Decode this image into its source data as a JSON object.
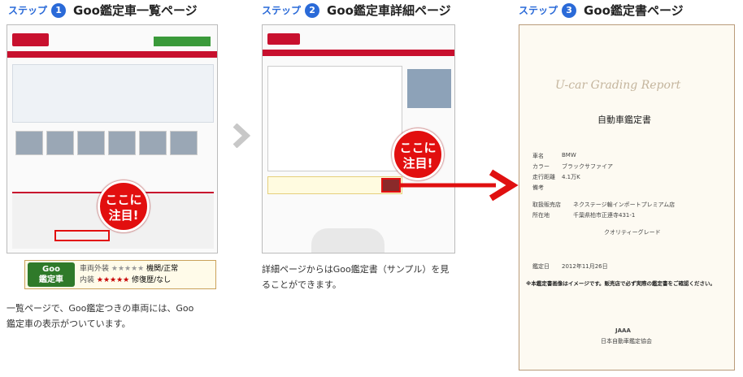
{
  "steps": [
    {
      "label": "ステップ",
      "num": "1",
      "title": "Goo鑑定車一覧ページ"
    },
    {
      "label": "ステップ",
      "num": "2",
      "title": "Goo鑑定車詳細ページ"
    },
    {
      "label": "ステップ",
      "num": "3",
      "title": "Goo鑑定書ページ"
    }
  ],
  "callout": {
    "line1": "ここに",
    "line2": "注目!"
  },
  "badge": {
    "logo_top": "Goo",
    "logo_bottom": "鑑定車",
    "row1_key": "車両外装",
    "row1_stars": "★★★★★",
    "row1_val": "機関/正常",
    "row2_key": "内装",
    "row2_stars": "★★★★★",
    "row2_val": "修復歴/なし"
  },
  "desc1": {
    "line1": "一覧ページで、Goo鑑定つきの車両には、Goo",
    "line2": "鑑定車の表示がついています。"
  },
  "desc2": {
    "line1": "詳細ページからはGoo鑑定書（サンプル）を見",
    "line2": "ることができます。"
  },
  "report": {
    "en_title": "U-car Grading Report",
    "jp_title": "自動車鑑定書",
    "name_label": "車名",
    "name_val": "BMW",
    "color_label": "カラー",
    "color_val": "ブラックサファイア",
    "mileage_label": "走行距離",
    "mileage_val": "4.1万K",
    "note_label": "備考",
    "shop_label": "取扱販売店",
    "shop_val": "ネクステージ輸インポートプレミアム店",
    "addr_label": "所在地",
    "addr_val": "千葉県柏市正連寺431-1",
    "quality_title": "クオリティーグレード",
    "date_label": "鑑定日",
    "date_val": "2012年11月26日",
    "notice": "※本鑑定書画像はイメージです。販売店で必ず実際の鑑定書をご確認ください。",
    "org_en": "JAAA",
    "org_jp": "日本自動車鑑定協会"
  },
  "colors": {
    "accent": "#2a6ad8",
    "callout": "#e20f0f",
    "arrow": "#e01010"
  }
}
